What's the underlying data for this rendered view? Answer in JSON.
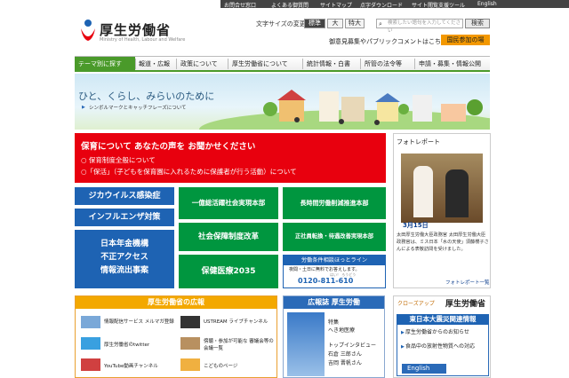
{
  "utility": {
    "links": [
      "お問合せ窓口",
      "よくある御質問",
      "サイトマップ",
      "点字ダウンロード",
      "サイト閲覧支援ツール",
      "English"
    ]
  },
  "header": {
    "ministry": "厚生労働省",
    "ministry_en": "Ministry of Health, Labour and Welfare",
    "fontsize_label": "文字サイズの変更",
    "fontsizes": [
      "標準",
      "大",
      "特大"
    ],
    "search_placeholder": "検索したい語句を入力してください",
    "search_button": "検索",
    "feedback": "御意見募集やパブリックコメントはこちら",
    "participation": "国民参加の場"
  },
  "nav": [
    "テーマ別に探す",
    "報道・広報",
    "政策について",
    "厚生労働省について",
    "統計情報・白書",
    "所管の法令等",
    "申請・募集・情報公開"
  ],
  "hero": {
    "title": "ひと、くらし、みらいのために",
    "link": "シンボルマークとキャッチフレーズについて"
  },
  "childcare": {
    "title": "保育について あなたの声を お聞かせください",
    "line1": "○ 保育制度全般について",
    "line2": "○「保活」（子どもを保育園に入れるために保護者が行う活動）について"
  },
  "tiles": {
    "zika": "ジカウイルス感染症",
    "flu": "インフルエンザ対策",
    "pension": [
      "日本年金機構",
      "不正アクセス",
      "情報流出事案"
    ],
    "ichioku": "一億総活躍社会実現本部",
    "choujikan": "長時間労働削減推進本部",
    "shakai": "社会保障制度改革",
    "seishain": "正社員転換・待遇改善実現本部",
    "hoken": "保健医療2035",
    "hotline_t": "労働条件相談ほっとライン",
    "hotline_s": "夜間・土日に無料でお答えします。",
    "hotline_n": "0120-811-610",
    "hotline_ruby": "はい！ ろうどう"
  },
  "photo": {
    "header": "フォトレポート",
    "date": "3月15日",
    "caption": "太田厚生労働大臣政務官 太田厚生労働大臣政務官は、ミス日本「水の天使」須藤櫻子さんによる表敬訪問を受けました。",
    "more": "フォトレポート一覧"
  },
  "pr": {
    "title": "厚生労働省の広報",
    "items": [
      "情報配信サービス メルマガ登録",
      "USTREAM ライブチャンネル",
      "厚生労働省のtwitter",
      "傍聴・参加が可能な 審議会等の会議一覧",
      "YouTube動画チャンネル",
      "こどものページ"
    ]
  },
  "magazine": {
    "title": "広報誌 厚生労働",
    "t1": "特集",
    "t2": "へき地医療",
    "t3": "トップインタビュー",
    "t4": "石倉 三郎さん",
    "t5": "吉岡 晋帆さん"
  },
  "closeup": {
    "tag": "クローズアップ",
    "title": "厚生労働省",
    "box": "東日本大震災関連情報",
    "items": [
      "厚生労働省からのお知らせ",
      "食品中の放射性物質への対応"
    ],
    "english": "English"
  },
  "colors": {
    "green": "#00963f",
    "blue": "#1e63b3",
    "red": "#e8000e",
    "orange": "#f3a800"
  }
}
